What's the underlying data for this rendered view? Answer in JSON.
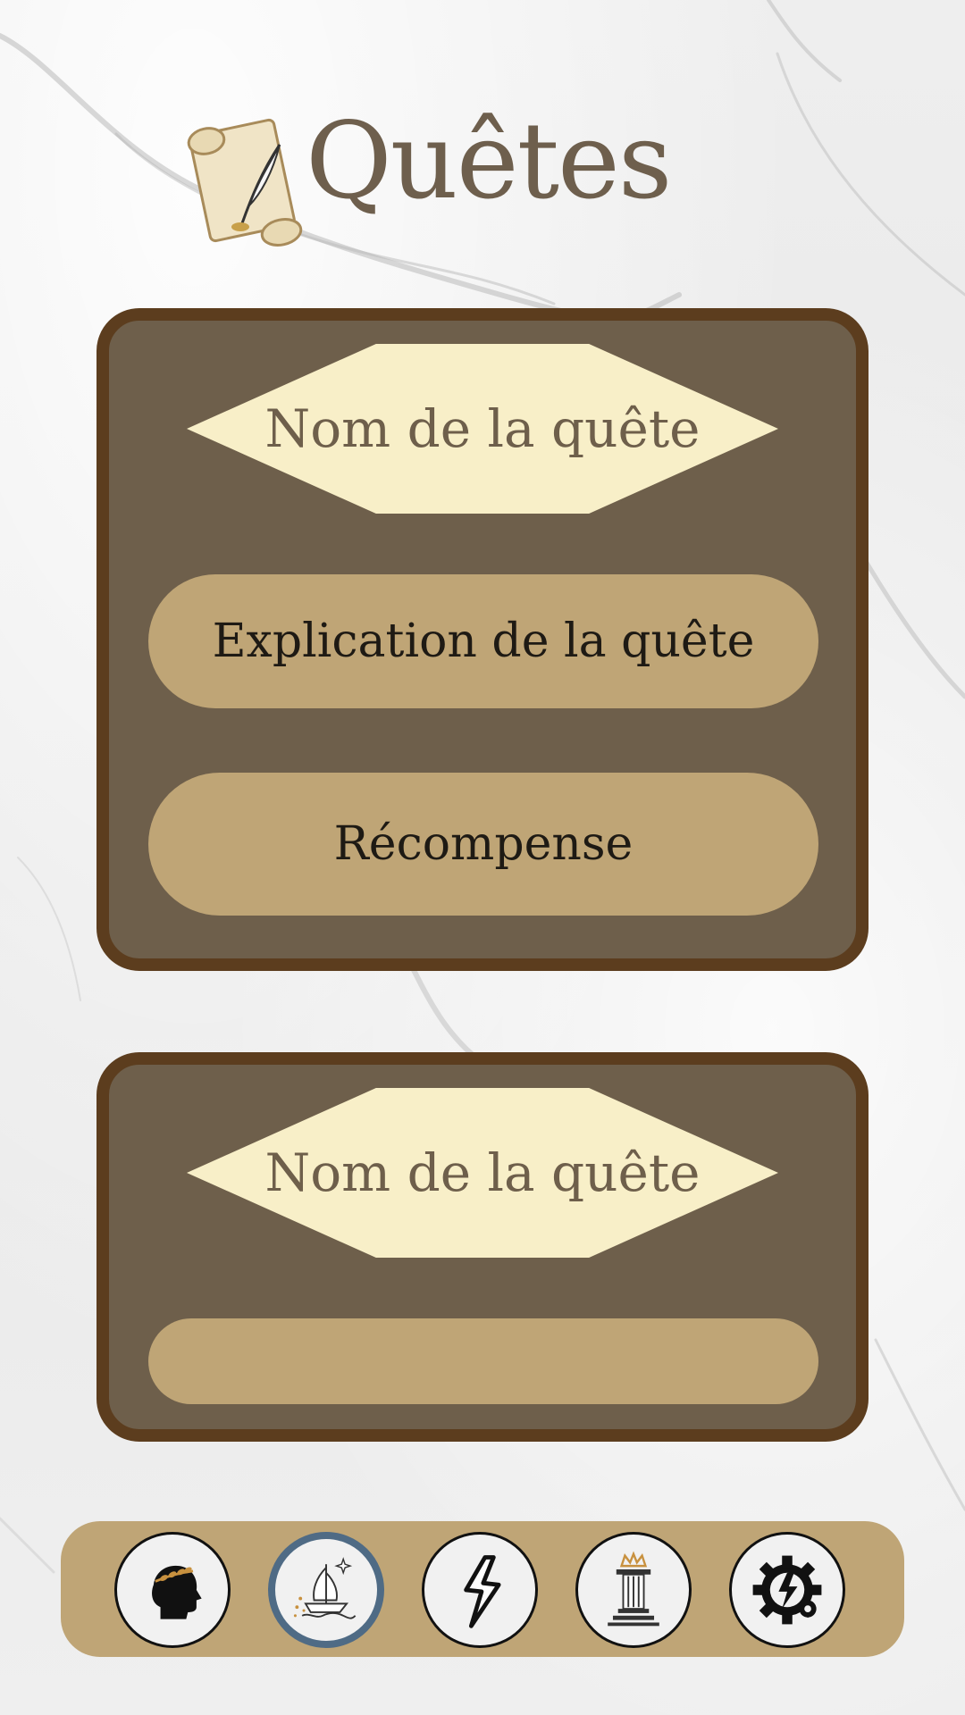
{
  "header": {
    "title": "Quêtes",
    "icon": "scroll-quill-icon"
  },
  "quests": [
    {
      "name": "Nom de la quête",
      "description": "Explication de la quête",
      "reward": "Récompense"
    },
    {
      "name": "Nom de la quête",
      "description": ""
    }
  ],
  "nav": {
    "items": [
      {
        "icon": "laurel-head-icon",
        "active": false
      },
      {
        "icon": "ship-icon",
        "active": true
      },
      {
        "icon": "lightning-icon",
        "active": false
      },
      {
        "icon": "column-crown-icon",
        "active": false
      },
      {
        "icon": "gear-lightning-icon",
        "active": false
      }
    ]
  },
  "colors": {
    "card_bg": "#6e5f4b",
    "card_border": "#5c3d1e",
    "banner": "#f8efc8",
    "pill": "#bfa576",
    "active_ring": "#4f6b85",
    "title": "#6e5f4d"
  }
}
